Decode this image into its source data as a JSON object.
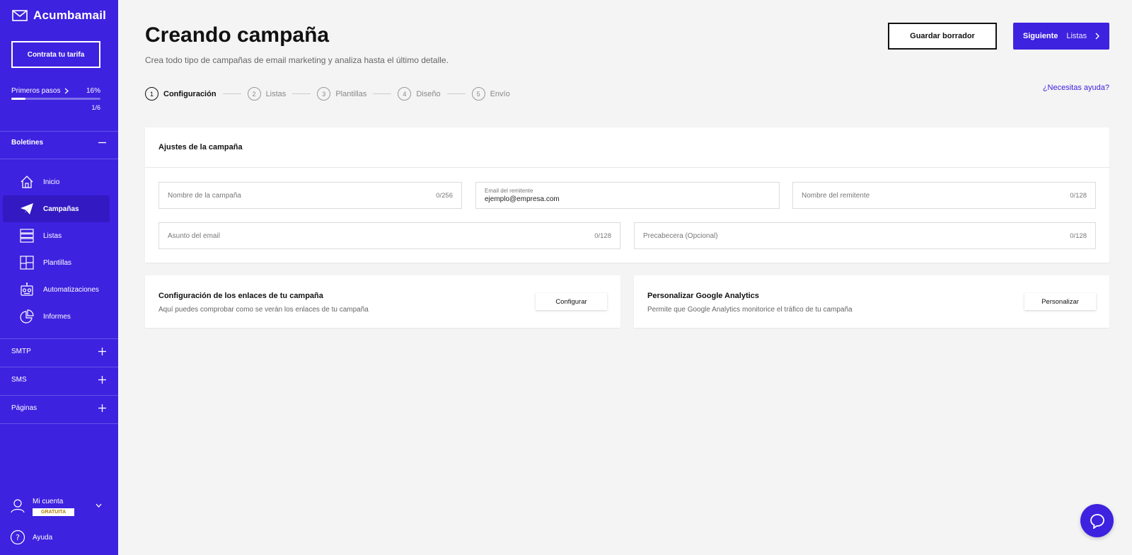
{
  "sidebar": {
    "brand": "Acumbamail",
    "contract_button": "Contrata tu tarifa",
    "first_steps": {
      "label": "Primeros pasos",
      "percent": "16%",
      "progress": 0.16,
      "count": "1/6"
    },
    "boletines": {
      "label": "Boletines",
      "items": [
        {
          "label": "Inicio",
          "icon": "home-icon"
        },
        {
          "label": "Campañas",
          "icon": "paper-plane-icon"
        },
        {
          "label": "Listas",
          "icon": "list-icon"
        },
        {
          "label": "Plantillas",
          "icon": "template-icon"
        },
        {
          "label": "Automatizaciones",
          "icon": "robot-icon"
        },
        {
          "label": "Informes",
          "icon": "pie-chart-icon"
        }
      ]
    },
    "smtp": "SMTP",
    "sms": "SMS",
    "paginas": "Páginas",
    "account": {
      "label": "Mi cuenta",
      "badge": "GRATUITA"
    },
    "help": "Ayuda"
  },
  "header": {
    "title": "Creando campaña",
    "subtitle": "Crea todo tipo de campañas de email marketing y analiza hasta el último detalle.",
    "save_draft": "Guardar borrador",
    "next_label": "Siguiente",
    "next_target": "Listas",
    "help_link": "¿Necesitas ayuda?"
  },
  "steps": [
    {
      "num": "1",
      "label": "Configuración"
    },
    {
      "num": "2",
      "label": "Listas"
    },
    {
      "num": "3",
      "label": "Plantillas"
    },
    {
      "num": "4",
      "label": "Diseño"
    },
    {
      "num": "5",
      "label": "Envío"
    }
  ],
  "settings": {
    "title": "Ajustes de la campaña",
    "campaign_name": {
      "placeholder": "Nombre de la campaña",
      "count": "0/256"
    },
    "sender_email": {
      "label": "Email del remitente",
      "value": "ejemplo@empresa.com"
    },
    "sender_name": {
      "placeholder": "Nombre del remitente",
      "count": "0/128"
    },
    "subject": {
      "placeholder": "Asunto del email",
      "count": "0/128"
    },
    "preheader": {
      "placeholder": "Precabecera (Opcional)",
      "count": "0/128"
    }
  },
  "links_card": {
    "title": "Configuración de los enlaces de tu campaña",
    "description": "Aquí puedes comprobar como se verán los enlaces de tu campaña",
    "button": "Configurar"
  },
  "analytics_card": {
    "title": "Personalizar Google Analytics",
    "description": "Permite que Google Analytics monitorice el tráfico de tu campaña",
    "button": "Personalizar"
  },
  "colors": {
    "brand": "#3d22e0",
    "active_nav": "#3219c2"
  }
}
